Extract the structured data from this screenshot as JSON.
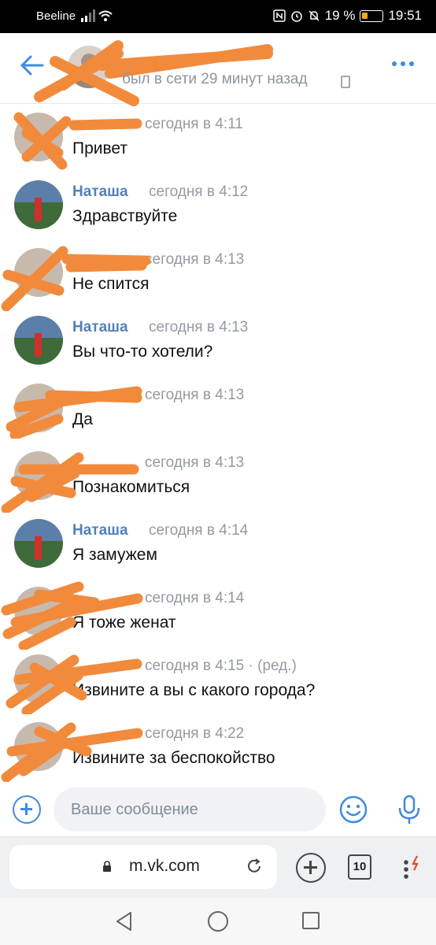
{
  "status_bar": {
    "carrier": "Beeline",
    "battery": "19 %",
    "time": "19:51"
  },
  "header": {
    "status": "был в сети 29 минут назад"
  },
  "messages": [
    {
      "author": "",
      "time": "сегодня в 4:11",
      "text": "Привет"
    },
    {
      "author": "Наташа",
      "time": "сегодня в 4:12",
      "text": "Здравствуйте"
    },
    {
      "author": "",
      "time": "сегодня в 4:13",
      "text": "Не спится"
    },
    {
      "author": "Наташа",
      "time": "сегодня в 4:13",
      "text": "Вы что-то хотели?"
    },
    {
      "author": "",
      "time": "сегодня в 4:13",
      "text": "Да"
    },
    {
      "author": "",
      "time": "сегодня в 4:13",
      "text": "Познакомиться"
    },
    {
      "author": "Наташа",
      "time": "сегодня в 4:14",
      "text": "Я замужем"
    },
    {
      "author": "",
      "time": "сегодня в 4:14",
      "text": "Я тоже женат"
    },
    {
      "author": "",
      "time": "сегодня в 4:15 · (ред.)",
      "text": "Извините а вы с какого города?"
    },
    {
      "author": "",
      "time": "сегодня в 4:22",
      "text": "Извините за беспокойство"
    }
  ],
  "compose": {
    "placeholder": "Ваше сообщение"
  },
  "browser": {
    "url": "m.vk.com",
    "tab_count": "10"
  },
  "colors": {
    "accent": "#3f8ae0",
    "name_link": "#5181b8",
    "redaction": "#f28a3c"
  }
}
